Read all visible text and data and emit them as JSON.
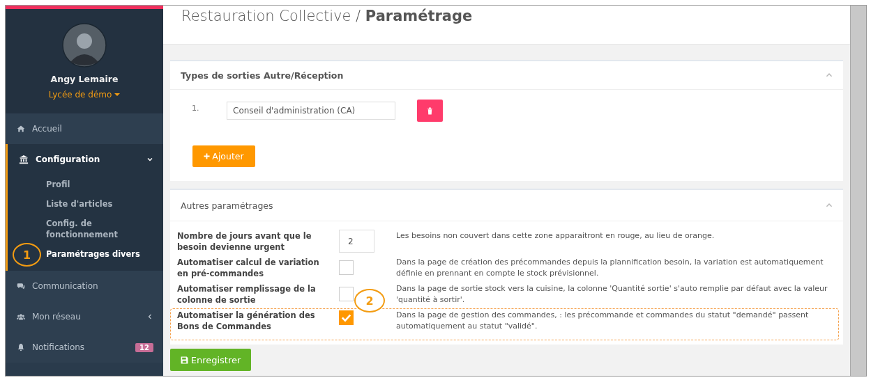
{
  "sidebar": {
    "user": {
      "name": "Angy Lemaire",
      "school": "Lycée de démo"
    },
    "items": [
      {
        "label": "Accueil",
        "expanded": false
      },
      {
        "label": "Configuration",
        "expanded": true,
        "children": [
          {
            "label": "Profil",
            "selected": false
          },
          {
            "label": "Liste d'articles",
            "selected": false
          },
          {
            "label": "Config. de fonctionnement",
            "selected": false
          },
          {
            "label": "Paramétrages divers",
            "selected": true,
            "callout": "1"
          }
        ]
      },
      {
        "label": "Communication",
        "expanded": false
      },
      {
        "label": "Mon réseau",
        "expanded": false,
        "has_submenu": true
      },
      {
        "label": "Notifications",
        "expanded": false,
        "badge": "12"
      }
    ]
  },
  "page": {
    "title": "Restauration Collective / ",
    "title_bold": "Paramétrage"
  },
  "panel_types": {
    "title": "Types de sorties Autre/Réception",
    "entries": [
      {
        "index": "1.",
        "value": "Conseil d'administration (CA)"
      }
    ],
    "add_button": "Ajouter"
  },
  "panel_settings": {
    "title": "Autres paramétrages",
    "rows": [
      {
        "label": "Nombre de jours avant que le besoin devienne urgent",
        "kind": "number",
        "value": "2",
        "description": "Les besoins non couvert dans cette zone apparaitront en rouge, au lieu de orange.",
        "highlighted": false
      },
      {
        "label": "Automatiser calcul de variation en pré-commandes",
        "kind": "checkbox",
        "checked": false,
        "description": "Dans la page de création des précommandes depuis la plannification besoin, la variation est automatiquement définie en prennant en compte le stock prévisionnel.",
        "highlighted": false
      },
      {
        "label": "Automatiser remplissage de la colonne de sortie",
        "kind": "checkbox",
        "checked": false,
        "callout": "2",
        "description": "Dans la page de sortie stock vers la cuisine, la colonne 'Quantité sortie' s'auto remplie par défaut avec la valeur 'quantité à sortir'.",
        "highlighted": false
      },
      {
        "label": "Automatiser la génération des Bons de Commandes",
        "kind": "checkbox",
        "checked": true,
        "description": "Dans la page de gestion des commandes, : les précommande et commandes du statut \"demandé\" passent automatiquement au statut \"validé\".",
        "highlighted": true
      }
    ]
  },
  "save_button": "Enregistrer"
}
